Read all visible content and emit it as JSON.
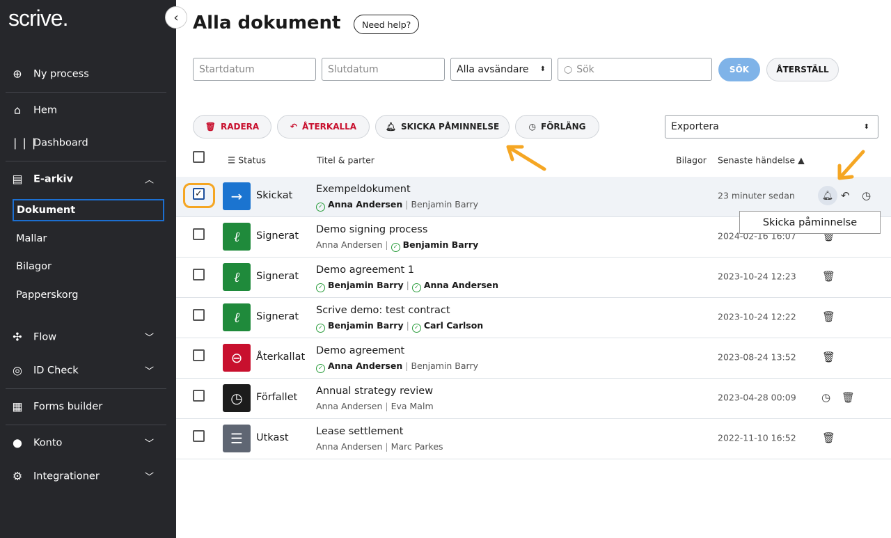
{
  "logo": "scrive.",
  "sidebar": {
    "new_process": "Ny process",
    "home": "Hem",
    "dashboard": "Dashboard",
    "earchive": "E-arkiv",
    "sub": [
      "Dokument",
      "Mallar",
      "Bilagor",
      "Papperskorg"
    ],
    "flow": "Flow",
    "idcheck": "ID Check",
    "forms": "Forms builder",
    "account": "Konto",
    "integrations": "Integrationer"
  },
  "header": {
    "title": "Alla dokument",
    "help": "Need help?"
  },
  "filters": {
    "start_placeholder": "Startdatum",
    "end_placeholder": "Slutdatum",
    "sender": "Alla avsändare",
    "search_placeholder": "Sök",
    "search_btn": "SÖK",
    "reset_btn": "ÅTERSTÄLL"
  },
  "actions": {
    "delete": "RADERA",
    "recall": "ÅTERKALLA",
    "remind": "SKICKA PÅMINNELSE",
    "extend": "FÖRLÄNG",
    "export": "Exportera"
  },
  "columns": {
    "status": "Status",
    "title": "Titel & parter",
    "attachments": "Bilagor",
    "latest": "Senaste händelse"
  },
  "tooltip": "Skicka påminnelse",
  "colors": {
    "sent": "#1b74d0",
    "signed": "#1f8a3b",
    "recalled": "#c8102e",
    "expired": "#1c1c1c",
    "draft": "#5f6673",
    "accent": "#f5a623"
  },
  "rows": [
    {
      "status": "Skickat",
      "title": "Exempeldokument",
      "p1": "Anna Andersen",
      "p1ok": true,
      "p2": "Benjamin Barry",
      "p2ok": false,
      "date": "23 minuter sedan"
    },
    {
      "status": "Signerat",
      "title": "Demo signing process",
      "p1": "Anna Andersen",
      "p1ok": false,
      "p2": "Benjamin Barry",
      "p2ok": true,
      "date": "2024-02-16 16:07"
    },
    {
      "status": "Signerat",
      "title": "Demo agreement 1",
      "p1": "Benjamin Barry",
      "p1ok": true,
      "p2": "Anna Andersen",
      "p2ok": true,
      "date": "2023-10-24 12:23"
    },
    {
      "status": "Signerat",
      "title": "Scrive demo: test contract",
      "p1": "Benjamin Barry",
      "p1ok": true,
      "p2": "Carl Carlson",
      "p2ok": true,
      "date": "2023-10-24 12:22"
    },
    {
      "status": "Återkallat",
      "title": "Demo agreement",
      "p1": "Anna Andersen",
      "p1ok": true,
      "p2": "Benjamin Barry",
      "p2ok": false,
      "date": "2023-08-24 13:52"
    },
    {
      "status": "Förfallet",
      "title": "Annual strategy review",
      "p1": "Anna Andersen",
      "p1ok": false,
      "p2": "Eva Malm",
      "p2ok": false,
      "date": "2023-04-28 00:09"
    },
    {
      "status": "Utkast",
      "title": "Lease settlement",
      "p1": "Anna Andersen",
      "p1ok": false,
      "p2": "Marc Parkes",
      "p2ok": false,
      "date": "2022-11-10 16:52"
    }
  ]
}
